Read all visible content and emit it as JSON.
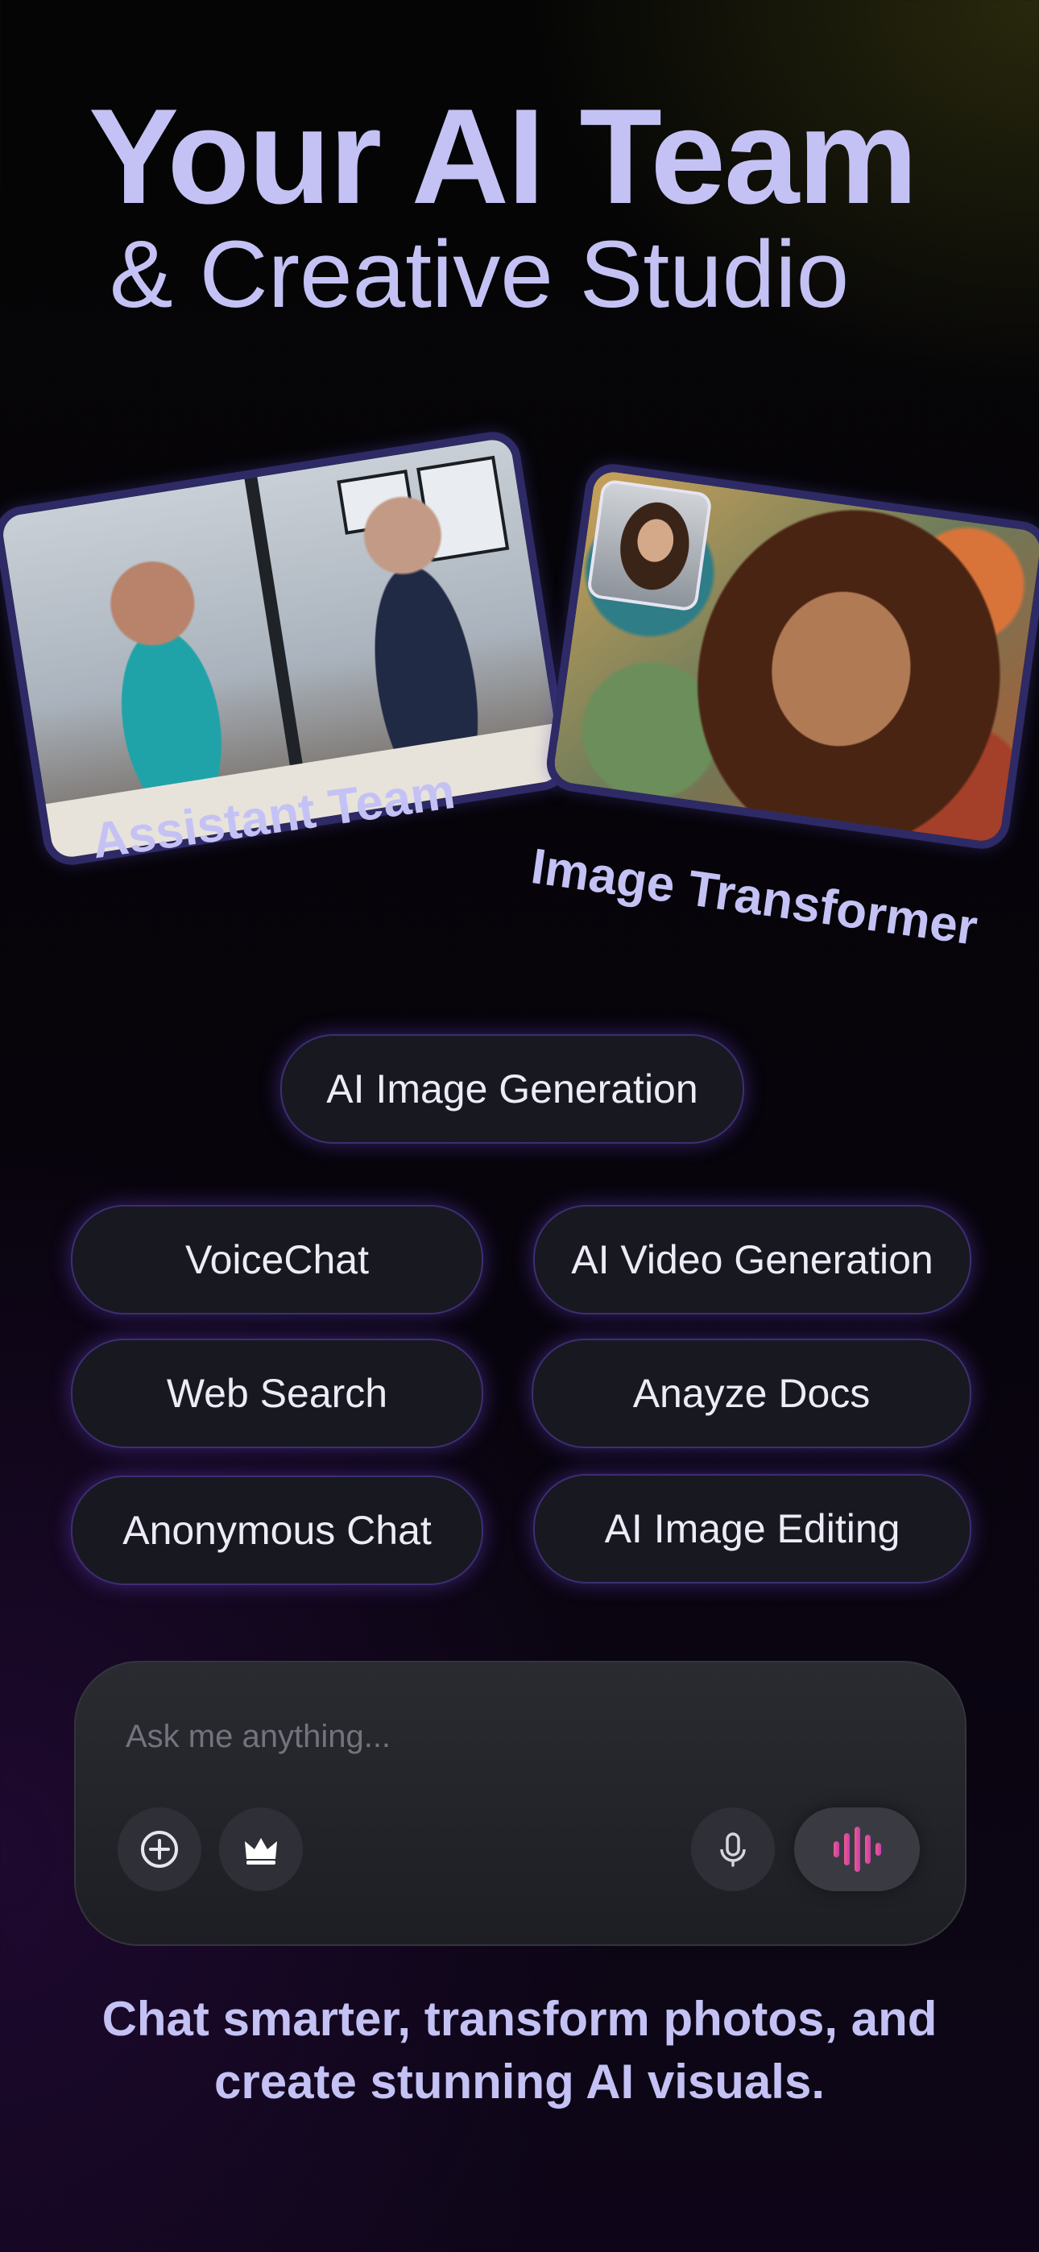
{
  "hero": {
    "title_line1": "Your AI Team",
    "title_line2": "& Creative Studio"
  },
  "showcase": {
    "left_caption": "Assistant Team",
    "right_caption": "Image Transformer"
  },
  "features": {
    "primary": "AI Image Generation",
    "items": [
      "VoiceChat",
      "AI Video Generation",
      "Web Search",
      "Anayze Docs",
      "Anonymous Chat",
      "AI Image Editing"
    ]
  },
  "composer": {
    "placeholder": "Ask me anything...",
    "icons": [
      "plus-circle-icon",
      "crown-icon",
      "microphone-icon",
      "waveform-icon"
    ]
  },
  "tagline": {
    "line1": "Chat smarter, transform photos, and",
    "line2": "create stunning AI visuals."
  },
  "colors": {
    "accent_text": "#c4c2f4",
    "pill_border_glow": "#6e46dc",
    "waveform": "#e0458f"
  }
}
